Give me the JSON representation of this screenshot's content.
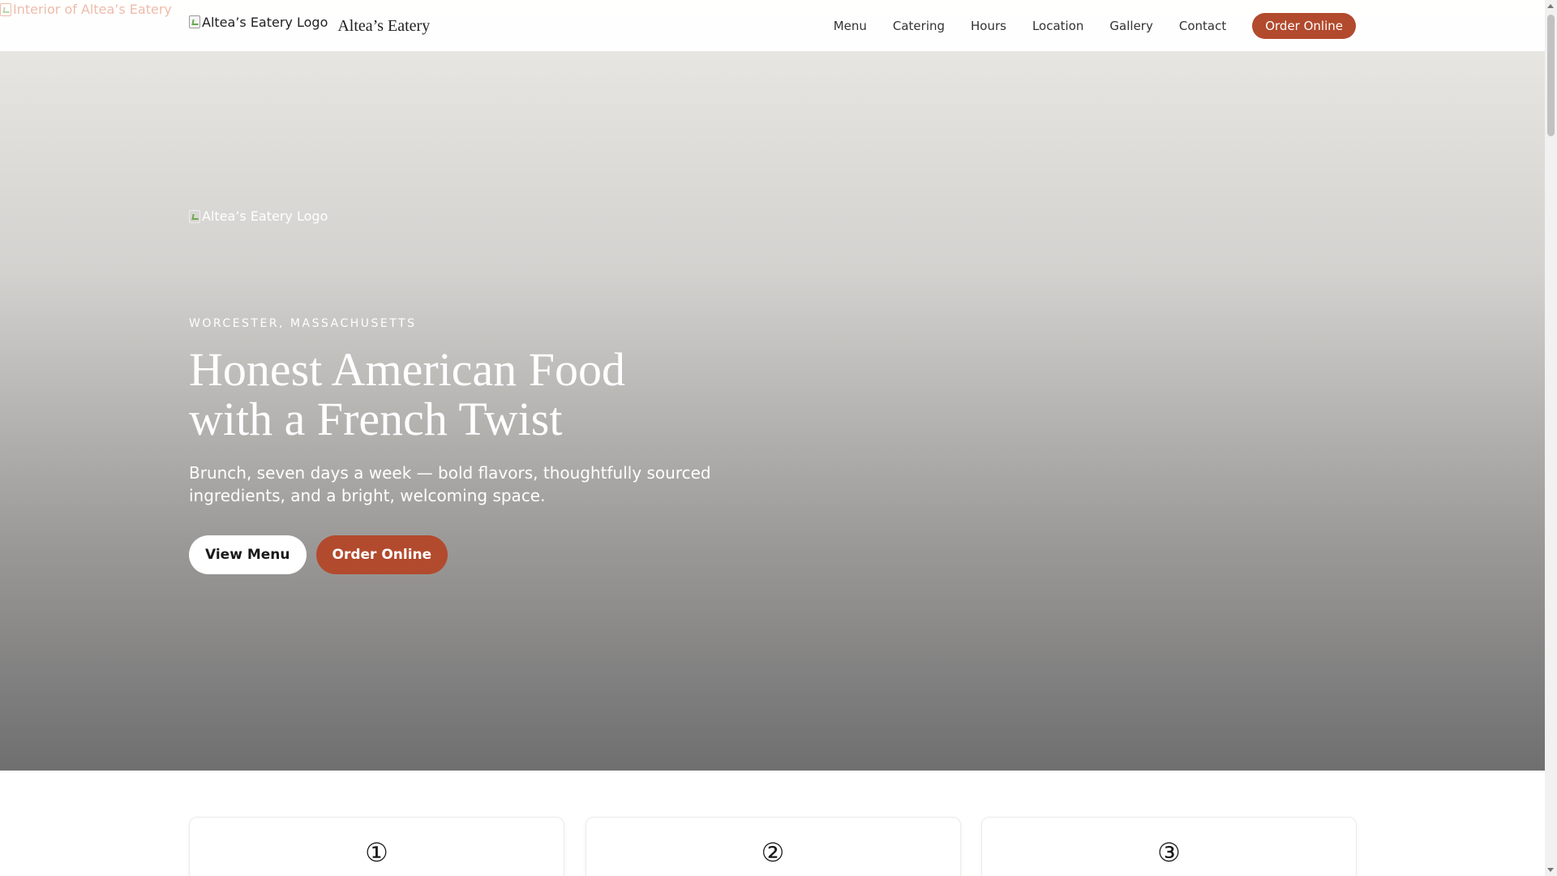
{
  "header": {
    "logo_alt": "Altea’s Eatery Logo",
    "brand_name": "Altea’s Eatery",
    "nav": [
      {
        "label": "Menu"
      },
      {
        "label": "Catering"
      },
      {
        "label": "Hours"
      },
      {
        "label": "Location"
      },
      {
        "label": "Gallery"
      },
      {
        "label": "Contact"
      }
    ],
    "cta_label": "Order Online"
  },
  "hero": {
    "background_alt": "Interior of Altea’s Eatery",
    "logo_alt": "Altea’s Eatery Logo",
    "kicker": "WORCESTER, MASSACHUSETTS",
    "title_line1": "Honest American Food",
    "title_line2": "with a French Twist",
    "subtitle": "Brunch, seven days a week — bold flavors, thoughtfully sourced ingredients, and a bright, welcoming space.",
    "primary_button": "View Menu",
    "secondary_button": "Order Online"
  },
  "features": {
    "cards": [
      {
        "number": "①"
      },
      {
        "number": "②"
      },
      {
        "number": "③"
      }
    ]
  },
  "colors": {
    "accent": "#b24a2e",
    "text_dark": "#1a1a1a",
    "hero_text": "#ffffff"
  },
  "icons": {
    "broken_image": "broken-image-icon"
  }
}
